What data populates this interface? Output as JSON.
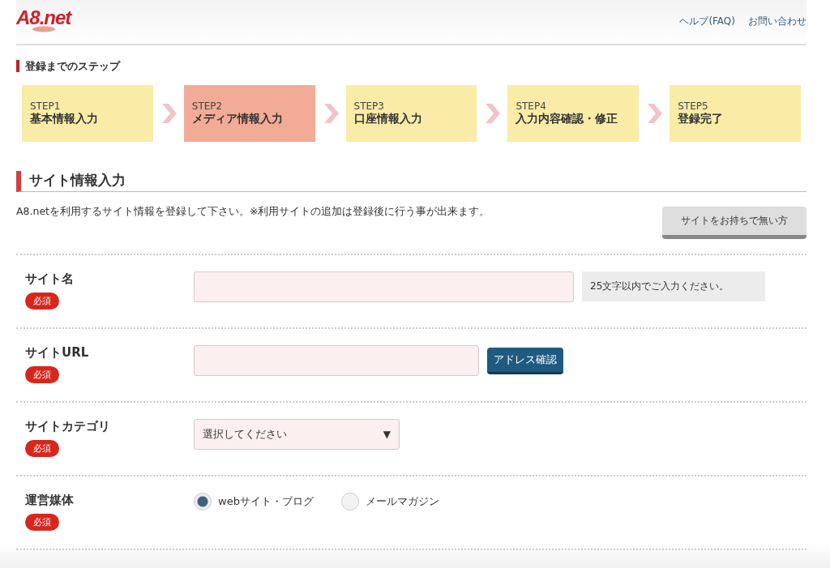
{
  "header": {
    "logo": "A8.net",
    "links": [
      "ヘルプ(FAQ)",
      "お問い合わせ"
    ]
  },
  "steps_heading": "登録までのステップ",
  "steps": [
    {
      "number": "STEP1",
      "label": "基本情報入力",
      "selected": false
    },
    {
      "number": "STEP2",
      "label": "メディア情報入力",
      "selected": true
    },
    {
      "number": "STEP3",
      "label": "口座情報入力",
      "selected": false
    },
    {
      "number": "STEP4",
      "label": "入力内容確認・修正",
      "selected": false
    },
    {
      "number": "STEP5",
      "label": "登録完了",
      "selected": false
    }
  ],
  "section_title": "サイト情報入力",
  "description": "A8.netを利用するサイト情報を登録して下さい。※利用サイトの追加は登録後に行う事が出来ます。",
  "no_site_button": "サイトをお持ちで無い方",
  "fields": [
    {
      "kind": "text",
      "label": "サイト名",
      "required_badge": "必須",
      "hint": "25文字以内でご入力ください。"
    },
    {
      "kind": "url",
      "label": "サイトURL",
      "required_badge": "必須",
      "button": "アドレス確認"
    },
    {
      "kind": "select",
      "label": "サイトカテゴリ",
      "required_badge": "必須",
      "value": "選択してください",
      "arrow": "▼"
    },
    {
      "kind": "radio",
      "label": "運営媒体",
      "required_badge": "必須",
      "options": [
        {
          "label": "webサイト・ブログ",
          "selected": true
        },
        {
          "label": "メールマガジン",
          "selected": false
        }
      ]
    }
  ]
}
